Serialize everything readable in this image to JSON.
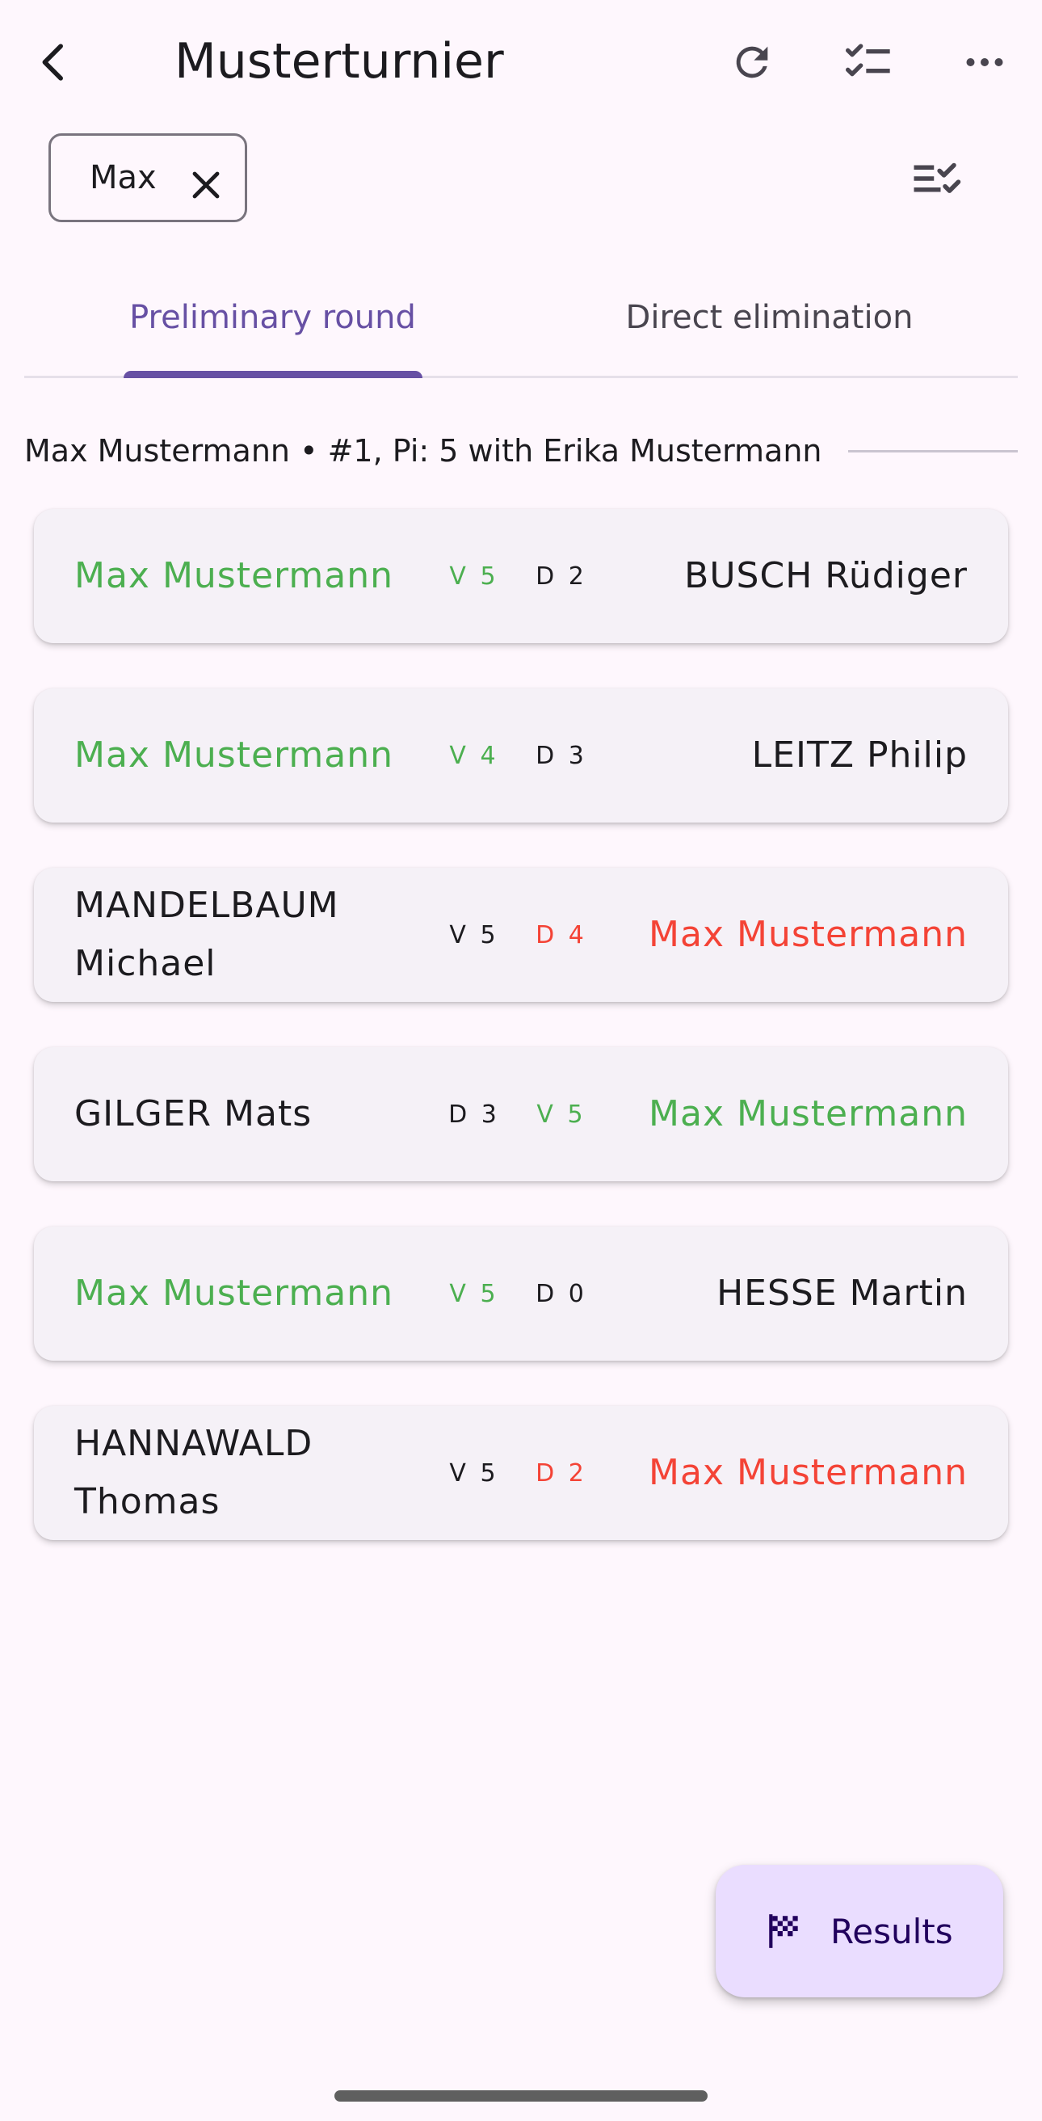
{
  "appbar": {
    "title": "Musterturnier",
    "icons": [
      "back-arrow-icon",
      "refresh-icon",
      "checklist-icon",
      "more-horizontal-icon"
    ]
  },
  "filter": {
    "chip_label": "Max",
    "chip_close_icon": "close-icon",
    "sort_icon": "sort-checklist-icon"
  },
  "tabs": {
    "selected": "Preliminary round",
    "items": [
      {
        "label": "Preliminary round"
      },
      {
        "label": "Direct elimination"
      }
    ]
  },
  "section": {
    "header": "Max Mustermann • #1, Pi: 5 with Erika Mustermann"
  },
  "colors": {
    "win": "#4caf50",
    "loss": "#f44336",
    "accent": "#6750a4",
    "fab_bg": "#eaddff"
  },
  "bouts": [
    {
      "left": "Max Mustermann",
      "left_score": "V 5",
      "right_score": "D 2",
      "right": "BUSCH Rüdiger",
      "left_color": "win",
      "left_score_color": "win",
      "right_score_color": "neutral",
      "right_color": "neutral"
    },
    {
      "left": "Max Mustermann",
      "left_score": "V 4",
      "right_score": "D 3",
      "right": "LEITZ Philip",
      "left_color": "win",
      "left_score_color": "win",
      "right_score_color": "neutral",
      "right_color": "neutral"
    },
    {
      "left": "MANDELBAUM Michael",
      "left_score": "V 5",
      "right_score": "D 4",
      "right": "Max Mustermann",
      "left_color": "neutral",
      "left_score_color": "neutral",
      "right_score_color": "loss",
      "right_color": "loss"
    },
    {
      "left": "GILGER Mats",
      "left_score": "D 3",
      "right_score": "V 5",
      "right": "Max Mustermann",
      "left_color": "neutral",
      "left_score_color": "neutral",
      "right_score_color": "win",
      "right_color": "win"
    },
    {
      "left": "Max Mustermann",
      "left_score": "V 5",
      "right_score": "D 0",
      "right": "HESSE Martin",
      "left_color": "win",
      "left_score_color": "win",
      "right_score_color": "neutral",
      "right_color": "neutral"
    },
    {
      "left": "HANNAWALD Thomas",
      "left_score": "V 5",
      "right_score": "D 2",
      "right": "Max Mustermann",
      "left_color": "neutral",
      "left_score_color": "neutral",
      "right_score_color": "loss",
      "right_color": "loss"
    }
  ],
  "fab": {
    "label": "Results",
    "icon": "checkered-flag-icon"
  }
}
